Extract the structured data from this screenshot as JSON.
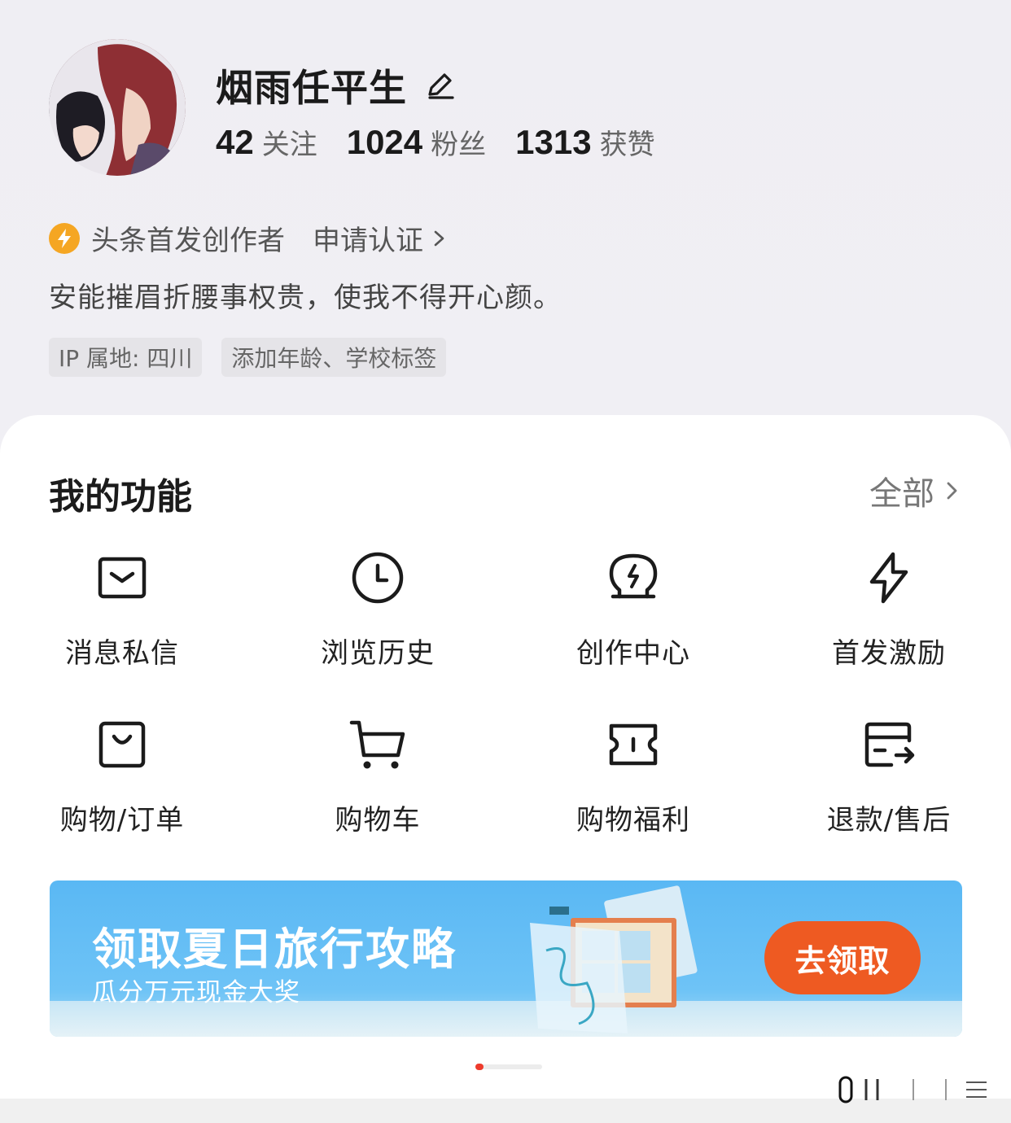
{
  "profile": {
    "name": "烟雨任平生",
    "stats": [
      {
        "num": "42",
        "label": "关注"
      },
      {
        "num": "1024",
        "label": "粉丝"
      },
      {
        "num": "1313",
        "label": "获赞"
      }
    ],
    "badge": "头条首发创作者",
    "apply": "申请认证",
    "bio": "安能摧眉折腰事权贵，使我不得开心颜。",
    "tags": [
      "IP 属地: 四川",
      "添加年龄、学校标签"
    ]
  },
  "functions": {
    "title": "我的功能",
    "all_label": "全部",
    "items": [
      {
        "label": "消息私信",
        "icon": "message-icon"
      },
      {
        "label": "浏览历史",
        "icon": "clock-icon"
      },
      {
        "label": "创作中心",
        "icon": "creator-bulb-icon"
      },
      {
        "label": "首发激励",
        "icon": "lightning-icon"
      },
      {
        "label": "购物/订单",
        "icon": "shopping-bag-icon"
      },
      {
        "label": "购物车",
        "icon": "cart-icon"
      },
      {
        "label": "购物福利",
        "icon": "ticket-icon"
      },
      {
        "label": "退款/售后",
        "icon": "refund-card-icon"
      }
    ]
  },
  "banner": {
    "title": "领取夏日旅行攻略",
    "subtitle": "瓜分万元现金大奖",
    "button": "去领取"
  },
  "colors": {
    "accent": "#ee5a22",
    "badge": "#f5a623",
    "banner_bg": "#5ab8f4",
    "pager_active": "#ee3b2c"
  }
}
